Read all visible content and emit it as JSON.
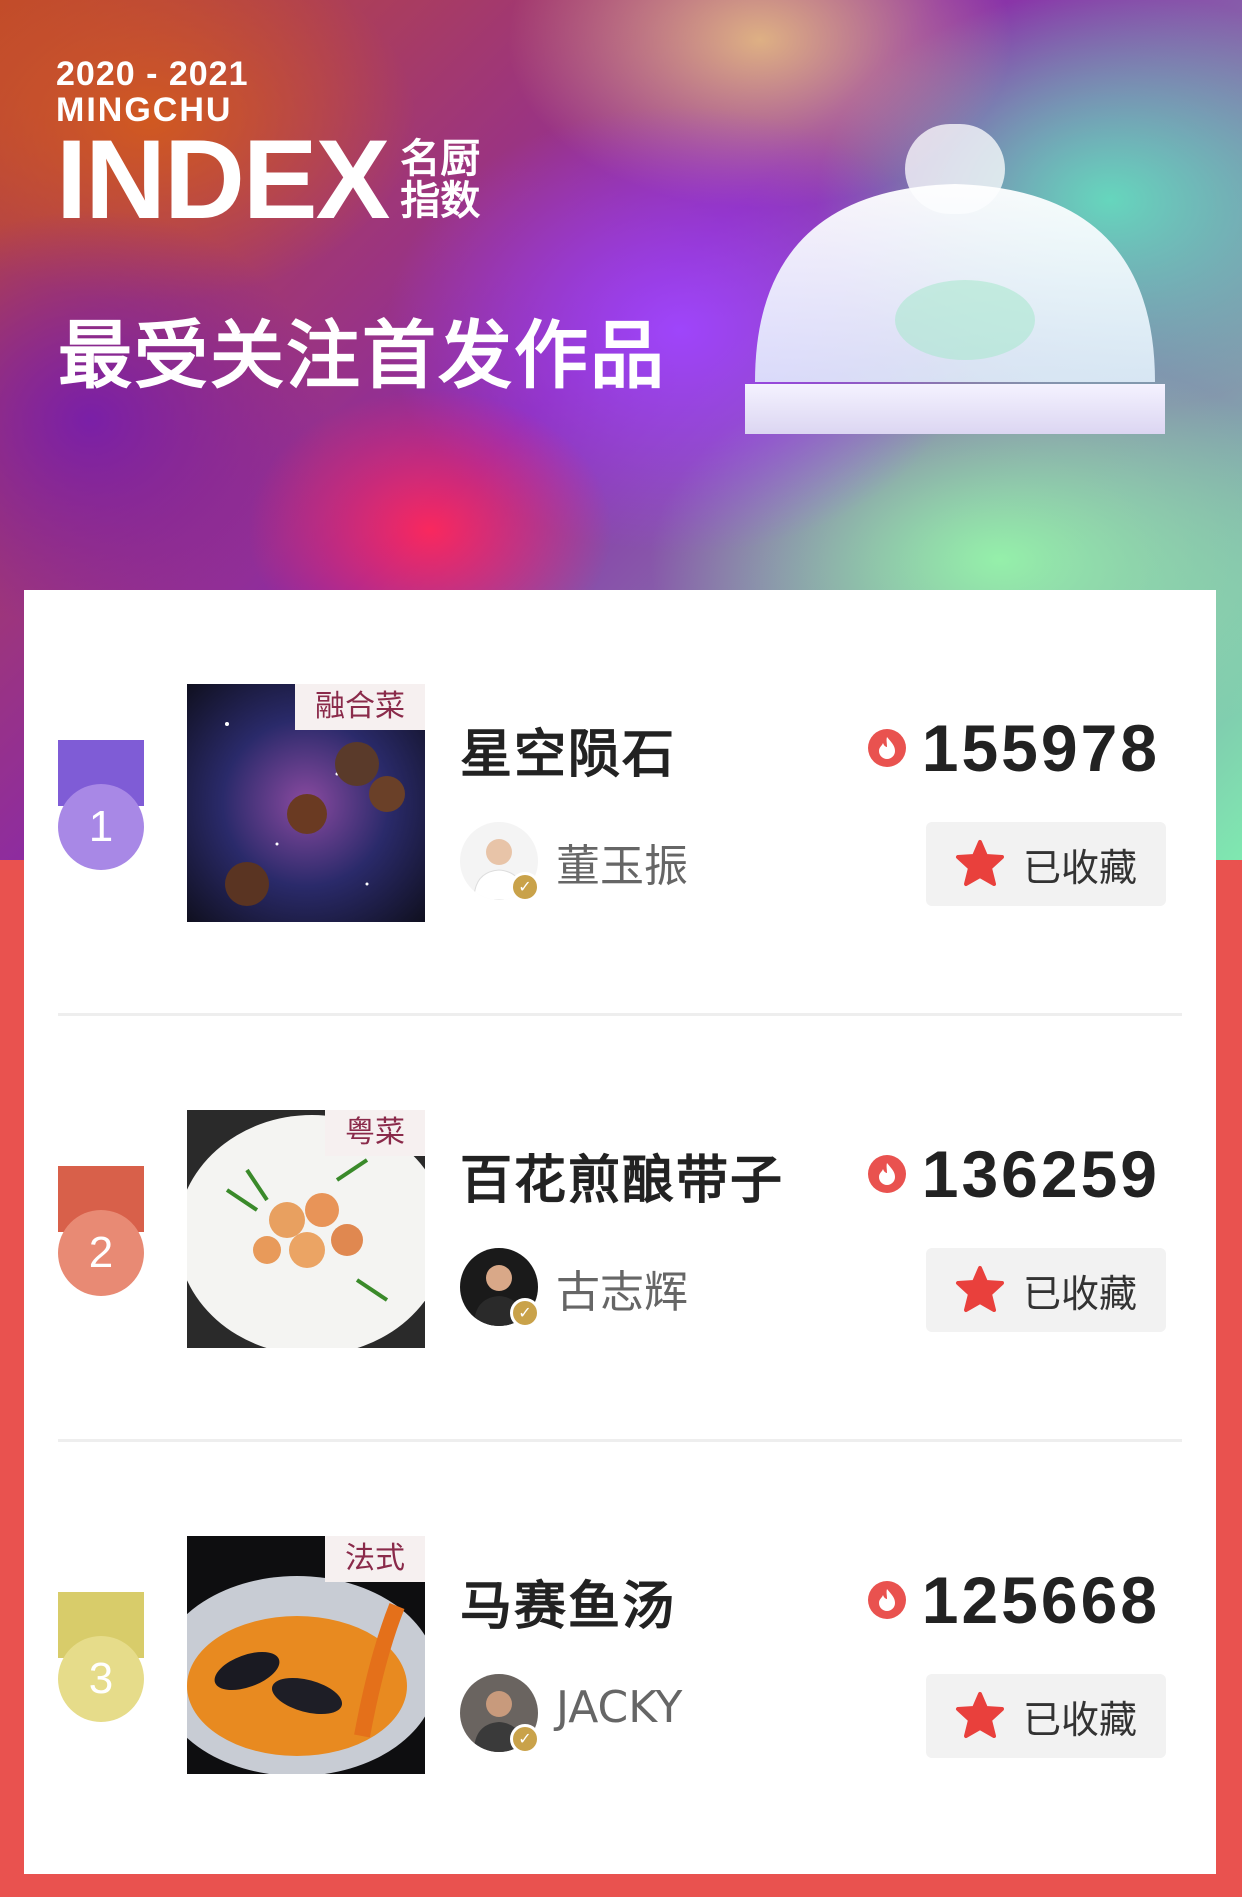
{
  "header": {
    "years": "2020 - 2021",
    "brand": "MINGCHU",
    "index": "INDEX",
    "cn_line1": "名厨",
    "cn_line2": "指数",
    "headline": "最受关注首发作品"
  },
  "colors": {
    "page_background": "#e9524f",
    "rank1": "#9a7ae0",
    "rank2": "#e07a64",
    "rank3": "#e6dc8a",
    "fire": "#e9524f",
    "star": "#e9403c",
    "tag_text": "#8a2a4a"
  },
  "ranking": [
    {
      "rank": "1",
      "tag": "融合菜",
      "title": "星空陨石",
      "chef": "董玉振",
      "score": "155978",
      "favorite_label": "已收藏"
    },
    {
      "rank": "2",
      "tag": "粤菜",
      "title": "百花煎酿带子",
      "chef": "古志辉",
      "score": "136259",
      "favorite_label": "已收藏"
    },
    {
      "rank": "3",
      "tag": "法式",
      "title": "马赛鱼汤",
      "chef": "JACKY",
      "score": "125668",
      "favorite_label": "已收藏"
    }
  ],
  "icons": {
    "hot": "fire-icon",
    "favorite": "star-icon",
    "verified": "verified-check-icon",
    "decoration": "cloche-icon"
  }
}
